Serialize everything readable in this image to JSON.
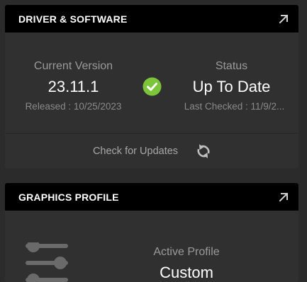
{
  "driver_card": {
    "title": "DRIVER & SOFTWARE",
    "current_version_label": "Current Version",
    "version": "23.11.1",
    "released": "Released : 10/25/2023",
    "status_label": "Status",
    "status": "Up To Date",
    "last_checked": "Last Checked : 11/9/2...",
    "check_updates_label": "Check for Updates"
  },
  "profile_card": {
    "title": "GRAPHICS PROFILE",
    "active_profile_label": "Active Profile",
    "profile_name": "Custom"
  },
  "icons": {
    "expand": "expand-arrow-icon",
    "status_check": "check-circle-icon",
    "refresh": "refresh-icon",
    "profile": "sliders-icon"
  },
  "colors": {
    "background": "#2b2b2b",
    "card": "#303030",
    "header": "#000000",
    "success": "#7cc43a",
    "muted_text": "#9a9a9a"
  }
}
